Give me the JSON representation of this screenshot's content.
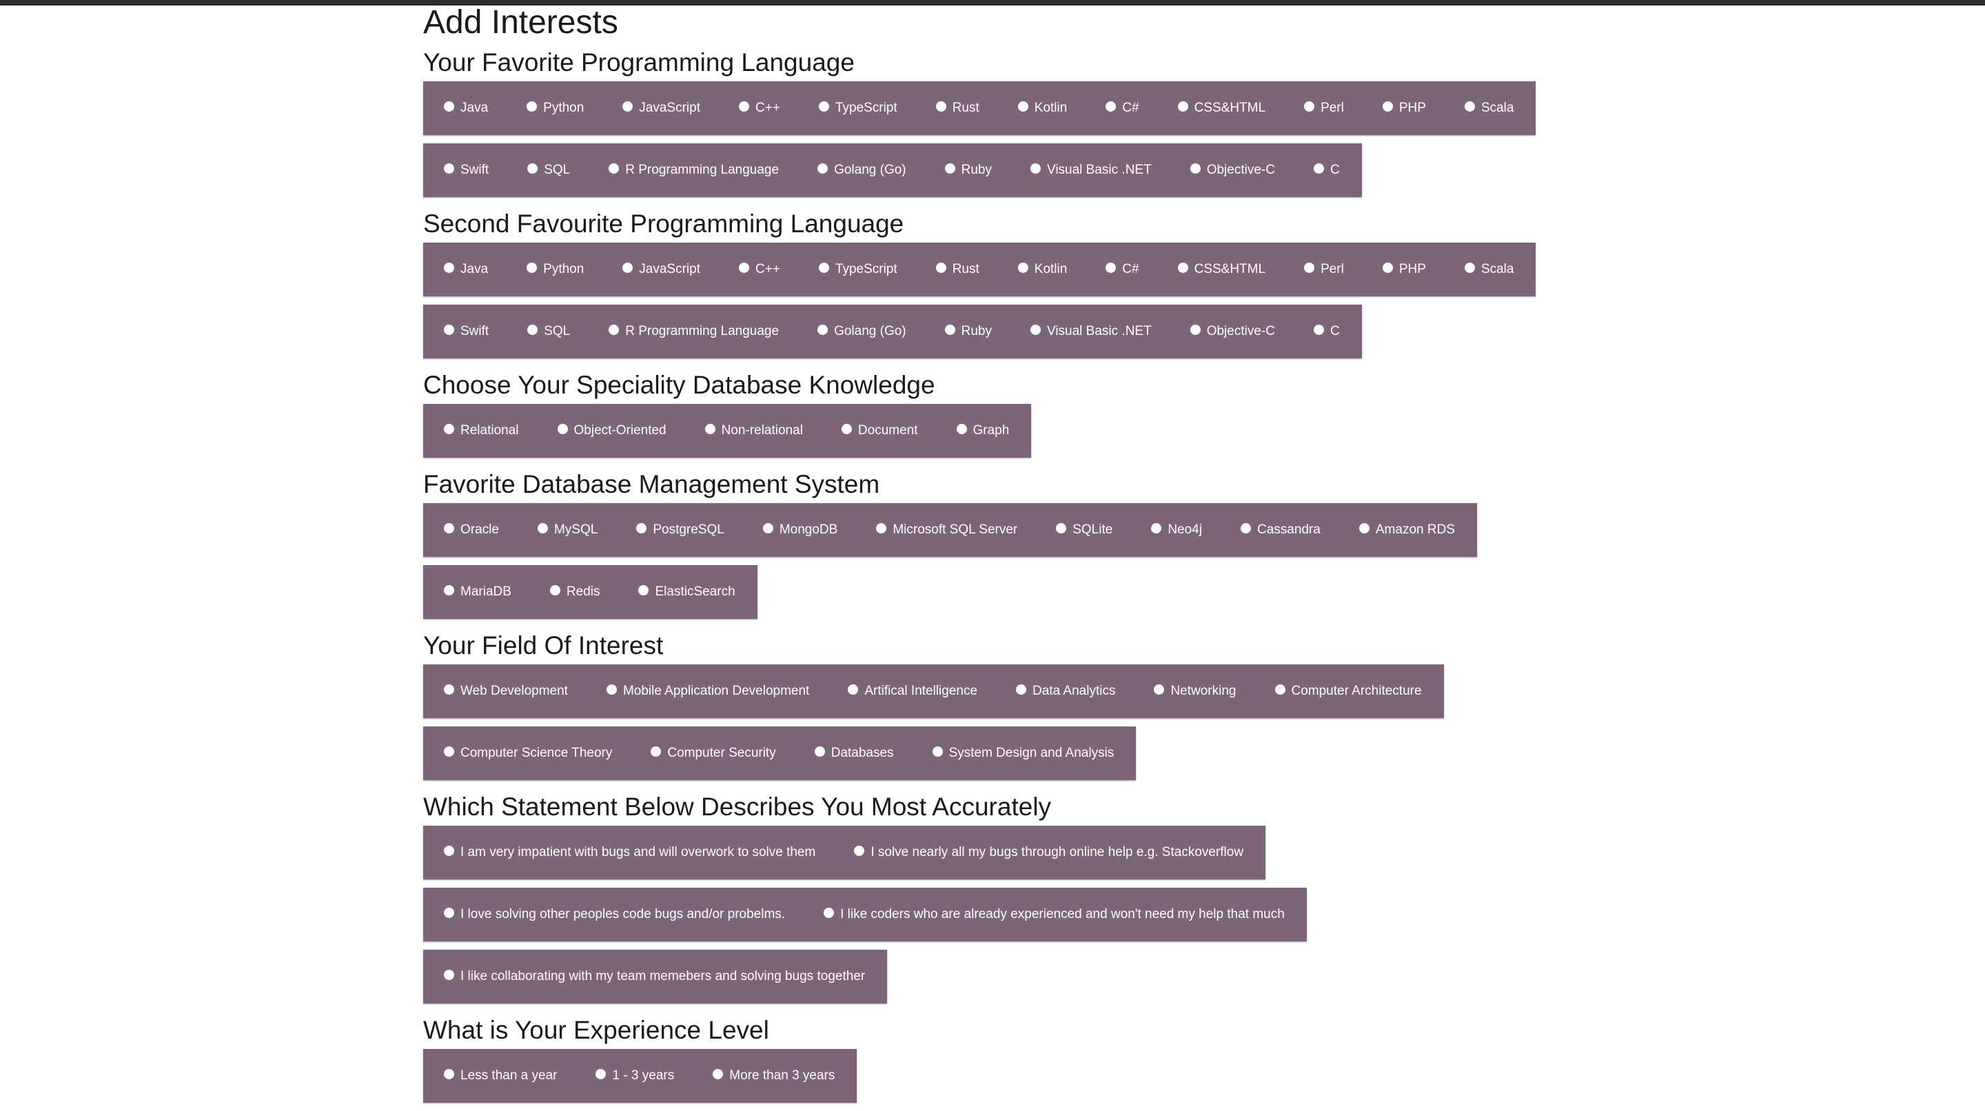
{
  "page_title": "Add Interests",
  "colors": {
    "row_bg": "#7c6479",
    "text": "#1a1a1a",
    "option_text": "#ffffff",
    "top_bar": "#2b2b2b"
  },
  "sections": [
    {
      "title": "Your Favorite Programming Language",
      "rows": [
        [
          "Java",
          "Python",
          "JavaScript",
          "C++",
          "TypeScript",
          "Rust",
          "Kotlin",
          "C#",
          "CSS&HTML",
          "Perl",
          "PHP",
          "Scala"
        ],
        [
          "Swift",
          "SQL",
          "R Programming Language",
          "Golang (Go)",
          "Ruby",
          "Visual Basic .NET",
          "Objective-C",
          "C"
        ]
      ]
    },
    {
      "title": "Second Favourite Programming Language",
      "rows": [
        [
          "Java",
          "Python",
          "JavaScript",
          "C++",
          "TypeScript",
          "Rust",
          "Kotlin",
          "C#",
          "CSS&HTML",
          "Perl",
          "PHP",
          "Scala"
        ],
        [
          "Swift",
          "SQL",
          "R Programming Language",
          "Golang (Go)",
          "Ruby",
          "Visual Basic .NET",
          "Objective-C",
          "C"
        ]
      ]
    },
    {
      "title": "Choose Your Speciality Database Knowledge",
      "rows": [
        [
          "Relational",
          "Object-Oriented",
          "Non-relational",
          "Document",
          "Graph"
        ]
      ]
    },
    {
      "title": "Favorite Database Management System",
      "rows": [
        [
          "Oracle",
          "MySQL",
          "PostgreSQL",
          "MongoDB",
          "Microsoft SQL Server",
          "SQLite",
          "Neo4j",
          "Cassandra",
          "Amazon RDS"
        ],
        [
          "MariaDB",
          "Redis",
          "ElasticSearch"
        ]
      ]
    },
    {
      "title": "Your Field Of Interest",
      "rows": [
        [
          "Web Development",
          "Mobile Application Development",
          "Artifical Intelligence",
          "Data Analytics",
          "Networking",
          "Computer Architecture"
        ],
        [
          "Computer Science Theory",
          "Computer Security",
          "Databases",
          "System Design and Analysis"
        ]
      ]
    },
    {
      "title": "Which Statement Below Describes You Most Accurately",
      "rows": [
        [
          "I am very impatient with bugs and will overwork to solve them",
          "I solve nearly all my bugs through online help e.g. Stackoverflow"
        ],
        [
          "I love solving other peoples code bugs and/or probelms.",
          "I like coders who are already experienced and won't need my help that much"
        ],
        [
          "I like collaborating with my team memebers and solving bugs together"
        ]
      ]
    },
    {
      "title": "What is Your Experience Level",
      "rows": [
        [
          "Less than a year",
          "1 - 3 years",
          "More than 3 years"
        ]
      ]
    }
  ]
}
